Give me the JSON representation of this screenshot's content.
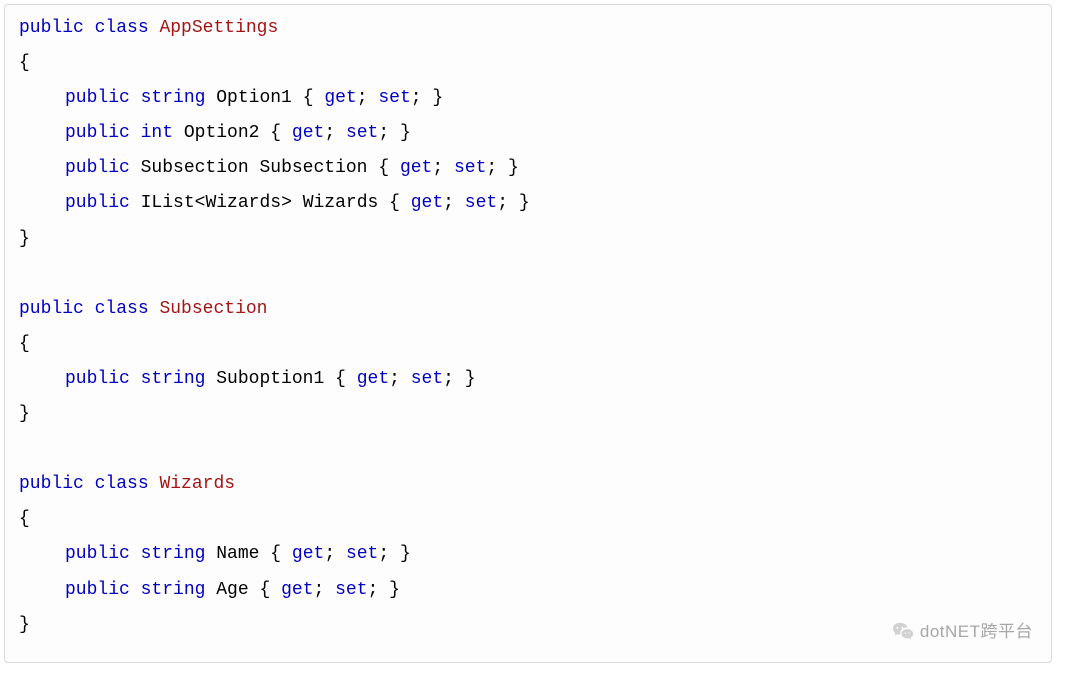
{
  "code": {
    "kw_public": "public",
    "kw_class": "class",
    "kw_string": "string",
    "kw_int": "int",
    "kw_get": "get",
    "kw_set": "set",
    "class1": "AppSettings",
    "class2": "Subsection",
    "class3": "Wizards",
    "prop_option1": "Option1",
    "prop_option2": "Option2",
    "prop_subsection": "Subsection",
    "prop_wizards": "Wizards",
    "prop_suboption1": "Suboption1",
    "prop_name": "Name",
    "prop_age": "Age",
    "type_subsection": "Subsection",
    "type_ilist_open": "IList<",
    "type_wizards": "Wizards",
    "type_ilist_close": ">",
    "brace_open": "{",
    "brace_close": "}",
    "semicolon": ";",
    "space": " "
  },
  "watermark": {
    "text": "dotNET跨平台"
  }
}
